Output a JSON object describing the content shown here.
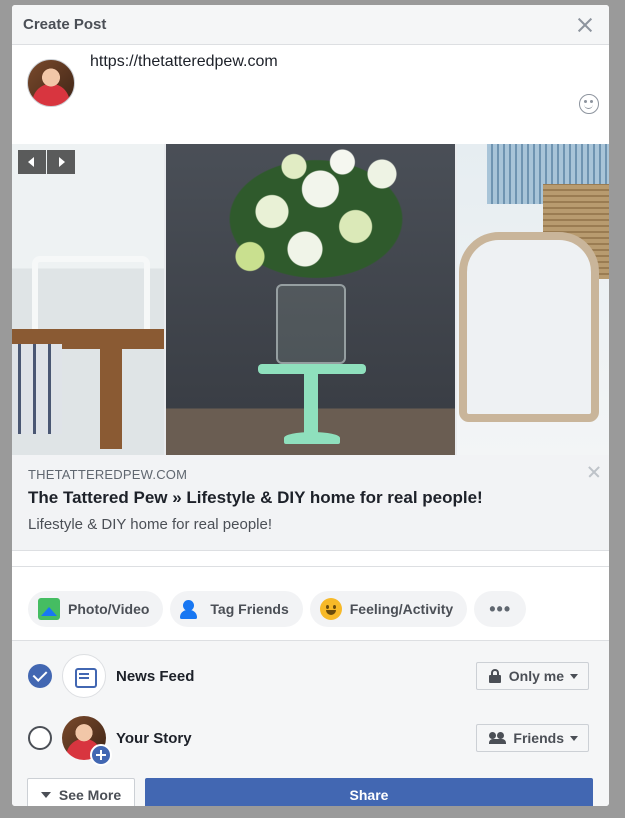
{
  "header": {
    "title": "Create Post"
  },
  "composer": {
    "text": "https://thetatteredpew.com"
  },
  "link_preview": {
    "domain": "THETATTEREDPEW.COM",
    "title": "The Tattered Pew » Lifestyle & DIY home for real people!",
    "description": "Lifestyle & DIY home for real people!"
  },
  "actions": [
    {
      "label": "Photo/Video",
      "icon": "photo-video-icon"
    },
    {
      "label": "Tag Friends",
      "icon": "tag-friends-icon"
    },
    {
      "label": "Feeling/Activity",
      "icon": "feeling-icon"
    },
    {
      "label": "•••",
      "icon": "more-icon"
    }
  ],
  "audience": {
    "news_feed": {
      "label": "News Feed",
      "checked": true,
      "privacy": "Only me"
    },
    "your_story": {
      "label": "Your Story",
      "checked": false,
      "privacy": "Friends"
    }
  },
  "footer": {
    "see_more": "See More",
    "share": "Share"
  },
  "colors": {
    "brand": "#4267b2",
    "header_bg": "#f5f6f7",
    "link_bg": "#f2f3f5"
  }
}
